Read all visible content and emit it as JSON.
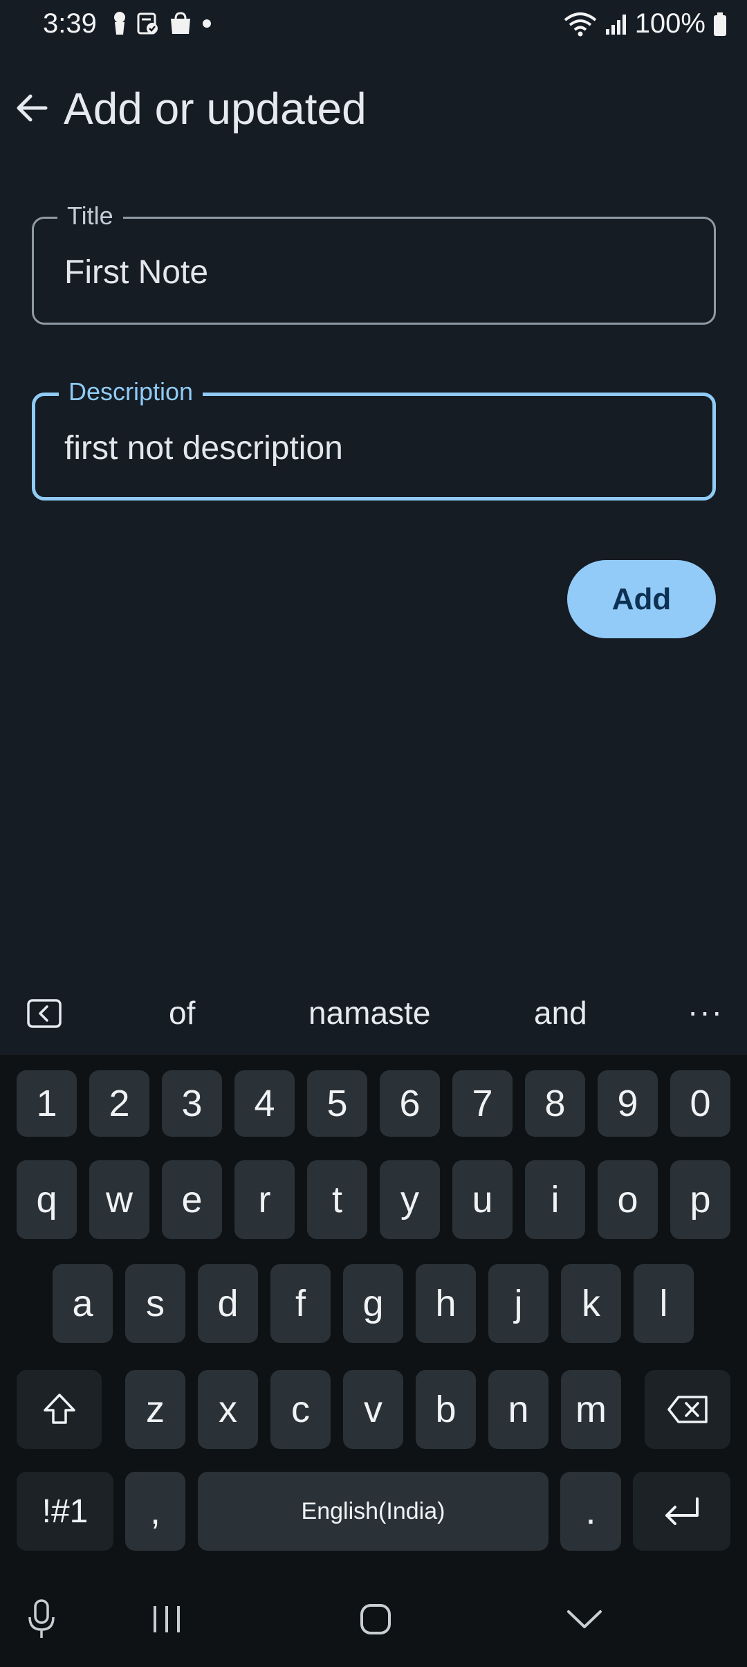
{
  "status_bar": {
    "time": "3:39",
    "battery": "100%",
    "icons": [
      "person-icon",
      "clipboard-check-icon",
      "shopping-bag-icon",
      "dot-icon",
      "wifi-icon",
      "signal-icon",
      "battery-icon"
    ]
  },
  "app_bar": {
    "title": "Add or updated",
    "back_icon": "arrow-left-icon"
  },
  "form": {
    "title_label": "Title",
    "title_value": "First Note",
    "description_label": "Description",
    "description_value": "first not description",
    "add_label": "Add"
  },
  "colors": {
    "background": "#161c24",
    "accent": "#8fcbf5",
    "button": "#92cbf8",
    "keyboard_bg": "#0f1214",
    "key_bg": "#2a3238"
  },
  "keyboard": {
    "suggestions": [
      "of",
      "namaste",
      "and"
    ],
    "more": "···",
    "row_numbers": [
      "1",
      "2",
      "3",
      "4",
      "5",
      "6",
      "7",
      "8",
      "9",
      "0"
    ],
    "row_top": [
      "q",
      "w",
      "e",
      "r",
      "t",
      "y",
      "u",
      "i",
      "o",
      "p"
    ],
    "row_mid": [
      "a",
      "s",
      "d",
      "f",
      "g",
      "h",
      "j",
      "k",
      "l"
    ],
    "row_bottom": [
      "z",
      "x",
      "c",
      "v",
      "b",
      "n",
      "m"
    ],
    "symbols_label": "!#1",
    "comma": ",",
    "space_label": "English(India)",
    "period": "."
  }
}
